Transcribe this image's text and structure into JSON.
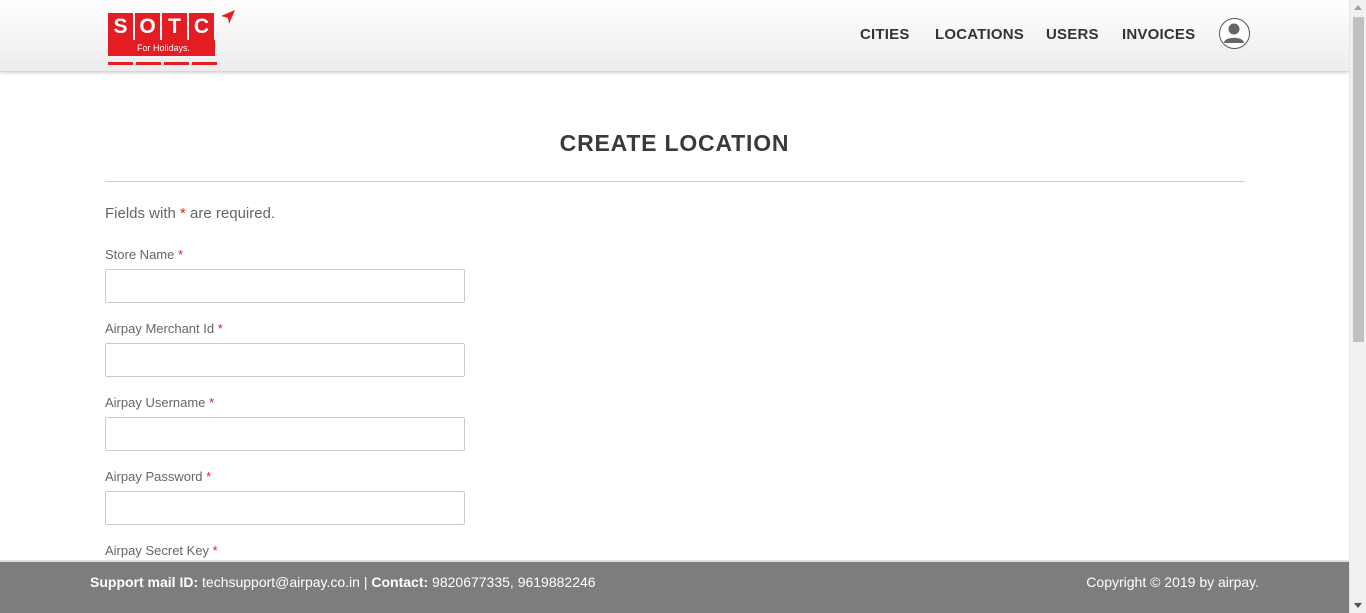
{
  "logo": {
    "letters": [
      "S",
      "O",
      "T",
      "C"
    ],
    "tagline": "For Holidays."
  },
  "nav": {
    "items": [
      {
        "label": "CITIES"
      },
      {
        "label": "LOCATIONS"
      },
      {
        "label": "USERS"
      },
      {
        "label": "INVOICES"
      }
    ],
    "avatar_icon": "user-avatar-icon"
  },
  "page": {
    "title": "CREATE LOCATION",
    "required_note_prefix": "Fields with",
    "required_marker": "*",
    "required_note_suffix": "are required."
  },
  "form": {
    "fields": [
      {
        "label": "Store Name",
        "value": ""
      },
      {
        "label": "Airpay Merchant Id",
        "value": ""
      },
      {
        "label": "Airpay Username",
        "value": ""
      },
      {
        "label": "Airpay Password",
        "value": ""
      },
      {
        "label": "Airpay Secret Key",
        "value": ""
      }
    ]
  },
  "footer": {
    "support_label": "Support mail ID:",
    "support_email": "techsupport@airpay.co.in",
    "separator": "|",
    "contact_label": "Contact:",
    "contact_numbers": "9820677335, 9619882246",
    "copyright": "Copyright © 2019 by airpay."
  },
  "colors": {
    "brand_red": "#e41c24",
    "footer_bg": "#7d7d7d",
    "title_text": "#3a3a3a"
  }
}
